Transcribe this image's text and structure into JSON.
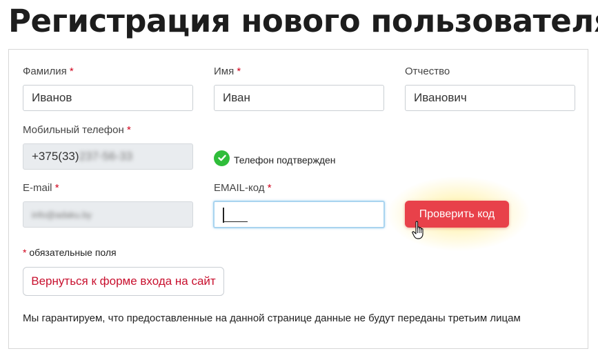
{
  "page": {
    "title": "Регистрация нового пользователя"
  },
  "form": {
    "last_name": {
      "label": "Фамилия",
      "value": "Иванов"
    },
    "first_name": {
      "label": "Имя",
      "value": "Иван"
    },
    "middle_name": {
      "label": "Отчество",
      "value": "Иванович"
    },
    "phone": {
      "label": "Мобильный телефон",
      "value_visible": "+375(33)",
      "value_blurred": "237-56-33",
      "verified_text": "Телефон подтвержден"
    },
    "email": {
      "label": "E-mail",
      "value_blurred": "info@adaku.by"
    },
    "email_code": {
      "label": "EMAIL-код",
      "value": ""
    },
    "required_mark": "*",
    "check_code_button": "Проверить код",
    "required_note": "обязательные поля",
    "back_button": "Вернуться к форме входа на сайт",
    "privacy_note": "Мы гарантируем, что предоставленные на данной странице данные не будут переданы третьим лицам"
  },
  "colors": {
    "required": "#d0021b",
    "primary_button": "#e8414a",
    "verified": "#2fbd3a",
    "back_button_text": "#c8102e"
  },
  "icons": {
    "verified": "check-circle-icon",
    "cursor": "hand-pointer-icon"
  }
}
